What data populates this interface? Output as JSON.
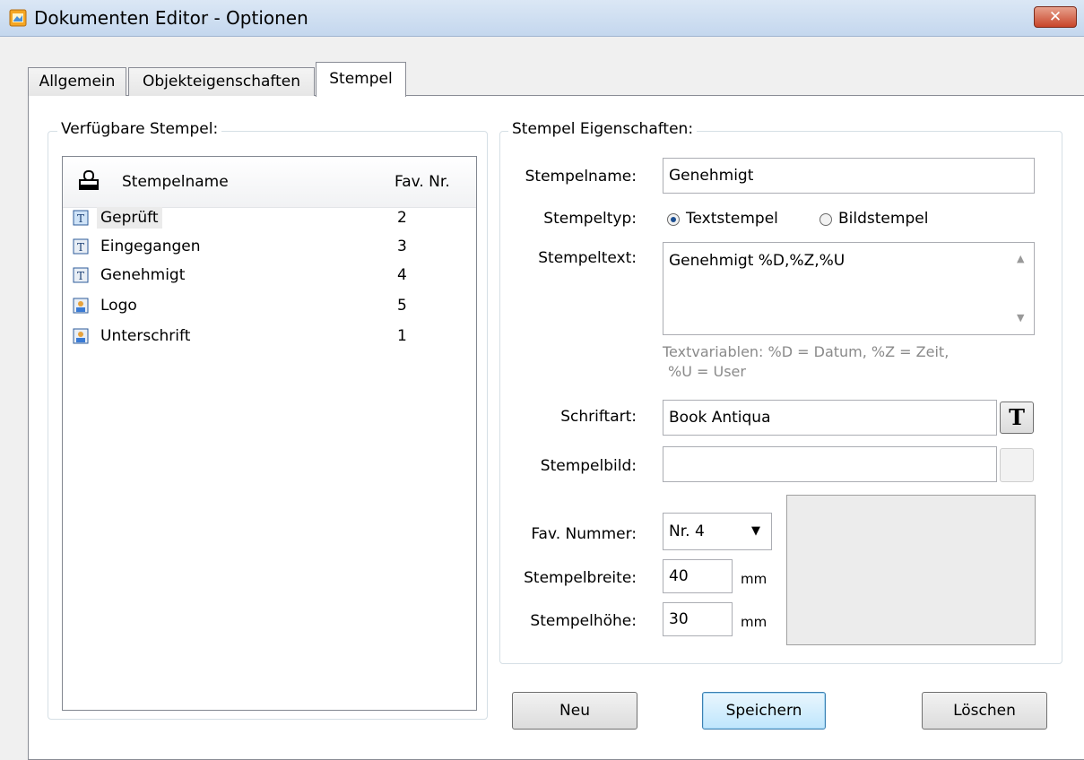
{
  "window": {
    "title": "Dokumenten Editor - Optionen",
    "close_label": "✕"
  },
  "tabs": [
    {
      "label": "Allgemein"
    },
    {
      "label": "Objekteigenschaften"
    },
    {
      "label": "Stempel"
    }
  ],
  "stamps_group": {
    "legend": "Verfügbare Stempel:",
    "columns": {
      "name": "Stempelname",
      "nr": "Fav. Nr."
    },
    "rows": [
      {
        "name": "Geprüft",
        "nr": "2",
        "icon": "text-stamp-icon"
      },
      {
        "name": "Eingegangen",
        "nr": "3",
        "icon": "text-stamp-icon"
      },
      {
        "name": "Genehmigt",
        "nr": "4",
        "icon": "text-stamp-icon"
      },
      {
        "name": "Logo",
        "nr": "5",
        "icon": "image-stamp-icon"
      },
      {
        "name": "Unterschrift",
        "nr": "1",
        "icon": "image-stamp-icon"
      }
    ]
  },
  "props_group": {
    "legend": "Stempel Eigenschaften:",
    "name_label": "Stempelname:",
    "name_value": "Genehmigt",
    "type_label": "Stempeltyp:",
    "type_text": "Textstempel",
    "type_image": "Bildstempel",
    "text_label": "Stempeltext:",
    "text_value": "Genehmigt %D,%Z,%U",
    "hint_line1": "Textvariablen: %D = Datum, %Z = Zeit,",
    "hint_line2": "%U = User",
    "font_label": "Schriftart:",
    "font_value": "Book Antiqua",
    "font_button": "T",
    "image_label": "Stempelbild:",
    "image_value": "",
    "fav_label": "Fav. Nummer:",
    "fav_value": "Nr. 4",
    "width_label": "Stempelbreite:",
    "width_value": "40",
    "width_unit": "mm",
    "height_label": "Stempelhöhe:",
    "height_value": "30",
    "height_unit": "mm"
  },
  "buttons": {
    "new": "Neu",
    "save": "Speichern",
    "delete": "Löschen"
  }
}
